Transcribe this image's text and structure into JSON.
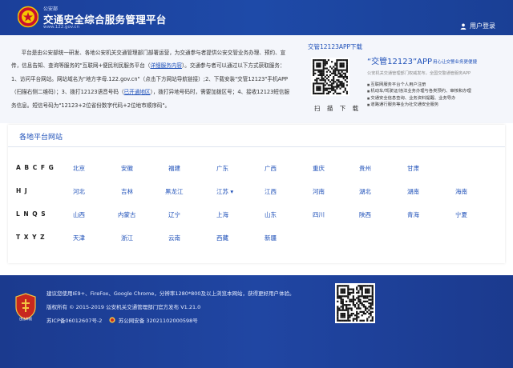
{
  "header": {
    "ministry": "公安部",
    "title": "交通安全综合服务管理平台",
    "url": "www.122.gov.cn",
    "login_label": "用户登录"
  },
  "intro": {
    "p1": "平台是由公安部统一研发、各地公安机关交通管理部门部署运营，为交通参与者提供公安交管业务办理、预约、宣传，信息告知、查询等服务的\"互联网+便民利民服务平台（",
    "link1": "详细服务内容",
    "p2": "）。交通参与者可以通过以下方式获取服务：1、访问平台网站。网站域名为\"地方字母.122.gov.cn\"（点击下方网站导航链接）;2、下载安装\"交管12123\"手机APP（扫描右侧二维码）；3、拨打12123语音号码（",
    "link2": "已开通地区",
    "p3": "），拨打异地号码时，需要加拨区号；4、接收12123短信服务信息。短信号码为\"12123+2位省份数字代码+2位地市顺序码\"。"
  },
  "app": {
    "heading": "交管12123APP下载",
    "scan_label": "扫 描 下 载",
    "title": "“交管12123”APP",
    "subtitle": "用心让交警业务更便捷",
    "desc": "公安机关交通管理部门权威发布，全国交警通管服务APP",
    "features": [
      "互联网服务平台个人用户注册",
      "机动车/驾驶证/违法业务办理与各类预约、审核和办理",
      "交通安全信息查询、业务资料提醒、业务导办",
      "道路通行服务等业为社交通安全服务"
    ]
  },
  "sites": {
    "title": "各地平台网站",
    "rows": [
      {
        "letters": "A B C F G",
        "items": [
          "北京",
          "安徽",
          "福建",
          "广东",
          "广西",
          "重庆",
          "贵州",
          "甘肃"
        ]
      },
      {
        "letters": "H J",
        "items": [
          "河北",
          "吉林",
          "黑龙江",
          "江苏 ▾",
          "江西",
          "河南",
          "湖北",
          "湖南",
          "海南"
        ]
      },
      {
        "letters": "L N Q S",
        "items": [
          "山西",
          "内蒙古",
          "辽宁",
          "上海",
          "山东",
          "四川",
          "陕西",
          "青海",
          "宁夏"
        ]
      },
      {
        "letters": "T X Y Z",
        "items": [
          "天津",
          "浙江",
          "云南",
          "西藏",
          "新疆"
        ]
      }
    ]
  },
  "footer": {
    "badge_label": "违法举报",
    "line1": "建议您使用IE9+、FireFox、Google Chrome，分辨率1280*800及以上浏览本网站，获得更好用户体验。",
    "line2": "版权所有 © 2015-2019 公安机关交通管理部门官方发布 V1.21.0",
    "icp": "苏ICP备06012607号-2",
    "police": "苏公网安备 32021102000598号"
  },
  "colors": {
    "header_bg": "#1e4aa8",
    "link": "#1d4fb8",
    "footer_bg": "#2046a3"
  }
}
